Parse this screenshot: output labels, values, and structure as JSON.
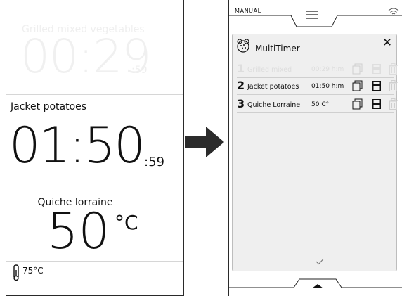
{
  "left": {
    "faded_title": "Grilled mixed vegetables",
    "faded_time": "00:29",
    "faded_seconds": ":59",
    "active_title": "Jacket potatoes",
    "active_time": "01:50",
    "active_seconds": ":59",
    "temp_title": "Quiche lorraine",
    "temp_value": "50",
    "temp_unit": "°C",
    "probe_temp": "75°C"
  },
  "device": {
    "mode_label": "MANUAL",
    "dialog_title": "MultiTimer",
    "close_label": "✕",
    "timers": [
      {
        "num": "1",
        "name": "Grilled mixed",
        "value": "00:29 h:m",
        "active": false
      },
      {
        "num": "2",
        "name": "Jacket potatoes",
        "value": "01:50 h:m",
        "active": true
      },
      {
        "num": "3",
        "name": "Quiche Lorraine",
        "value": "50 C°",
        "active": true
      }
    ]
  },
  "colors": {
    "ink": "#111111",
    "faded": "#e0e0e0",
    "dialog_bg": "#efefef"
  },
  "icons": [
    "probe-icon",
    "arrow-right-icon",
    "wifi-icon",
    "menu-icon",
    "multitimer-icon",
    "close-icon",
    "copy-icon",
    "save-icon",
    "delete-icon",
    "check-icon",
    "chevron-up-icon"
  ]
}
